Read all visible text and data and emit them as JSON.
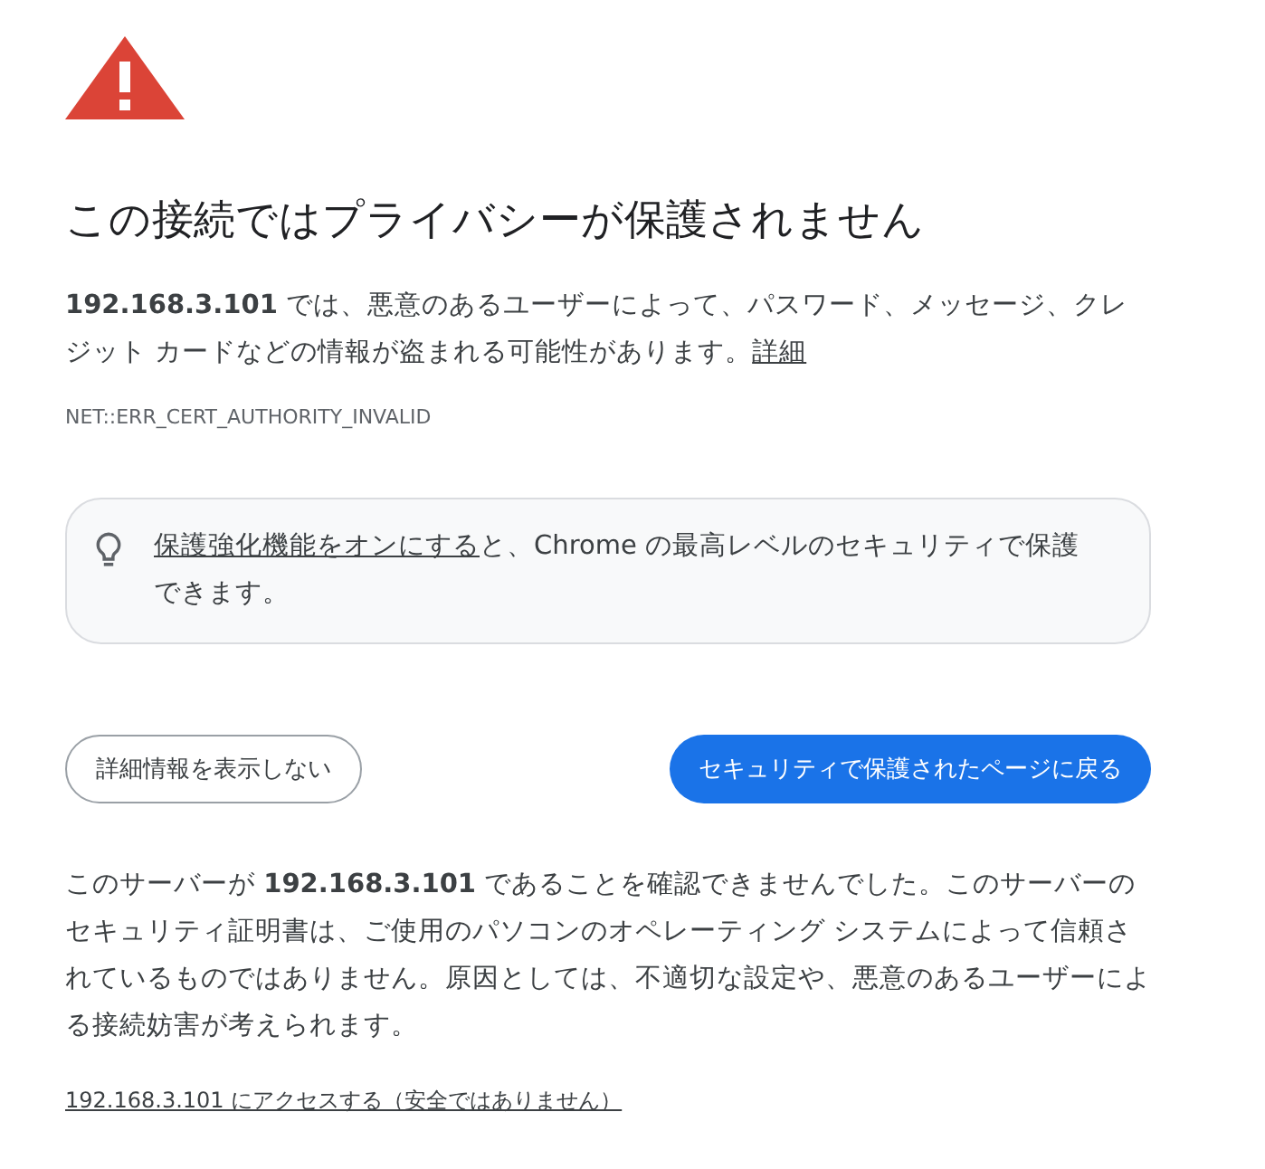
{
  "title": "この接続ではプライバシーが保護されません",
  "warning": {
    "text": "**192.168.3.101** では、悪意のあるユーザーによって、パスワード、メッセージ、クレジット カードなどの情報が盗まれる可能性があります。",
    "link": "詳細"
  },
  "error_code": "NET::ERR_CERT_AUTHORITY_INVALID",
  "tip": {
    "link": "保護強化機能をオンにする",
    "text": "と、Chrome の最高レベルのセキュリティで保護できます。"
  },
  "buttons": [
    {
      "label": "詳細情報を表示しない",
      "kind": "secondary"
    },
    {
      "label": "セキュリティで保護されたページに戻る",
      "kind": "primary"
    }
  ],
  "details": "このサーバーが **192.168.3.101** であることを確認できませんでした。このサーバーのセキュリティ証明書は、ご使用のパソコンのオペレーティング システムによって信頼されているものではありません。原因としては、不適切な設定や、悪意のあるユーザーによる接続妨害が考えられます。",
  "proceed_link": "192.168.3.101 にアクセスする（安全ではありません）"
}
